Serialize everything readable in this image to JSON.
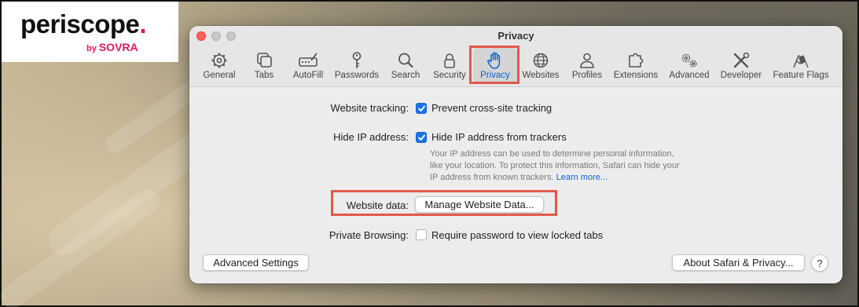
{
  "branding": {
    "name": "periscope",
    "dot": ".",
    "by": "by",
    "company": "SOVRA"
  },
  "window": {
    "title": "Privacy"
  },
  "tabs": [
    {
      "label": "General",
      "icon": "gear-icon"
    },
    {
      "label": "Tabs",
      "icon": "tabs-icon"
    },
    {
      "label": "AutoFill",
      "icon": "autofill-icon"
    },
    {
      "label": "Passwords",
      "icon": "key-icon"
    },
    {
      "label": "Search",
      "icon": "search-icon"
    },
    {
      "label": "Security",
      "icon": "lock-icon"
    },
    {
      "label": "Privacy",
      "icon": "hand-icon",
      "active": true
    },
    {
      "label": "Websites",
      "icon": "globe-icon"
    },
    {
      "label": "Profiles",
      "icon": "person-icon"
    },
    {
      "label": "Extensions",
      "icon": "puzzle-icon"
    },
    {
      "label": "Advanced",
      "icon": "gears-icon"
    },
    {
      "label": "Developer",
      "icon": "tools-icon"
    },
    {
      "label": "Feature Flags",
      "icon": "flags-icon"
    }
  ],
  "settings": {
    "tracking": {
      "label": "Website tracking:",
      "option": "Prevent cross-site tracking",
      "checked": true
    },
    "ip": {
      "label": "Hide IP address:",
      "option": "Hide IP address from trackers",
      "checked": true,
      "desc_line1": "Your IP address can be used to determine personal information,",
      "desc_line2": "like your location. To protect this information, Safari can hide your",
      "desc_line3": "IP address from known trackers.",
      "learn_more": "Learn more..."
    },
    "website_data": {
      "label": "Website data:",
      "button": "Manage Website Data..."
    },
    "private": {
      "label": "Private Browsing:",
      "option": "Require password to view locked tabs",
      "checked": false
    }
  },
  "footer": {
    "advanced_button": "Advanced Settings",
    "about_button": "About Safari & Privacy...",
    "help": "?"
  },
  "colors": {
    "accent": "#0a64d8",
    "highlight": "#e2584b",
    "brand": "#e2175f"
  }
}
